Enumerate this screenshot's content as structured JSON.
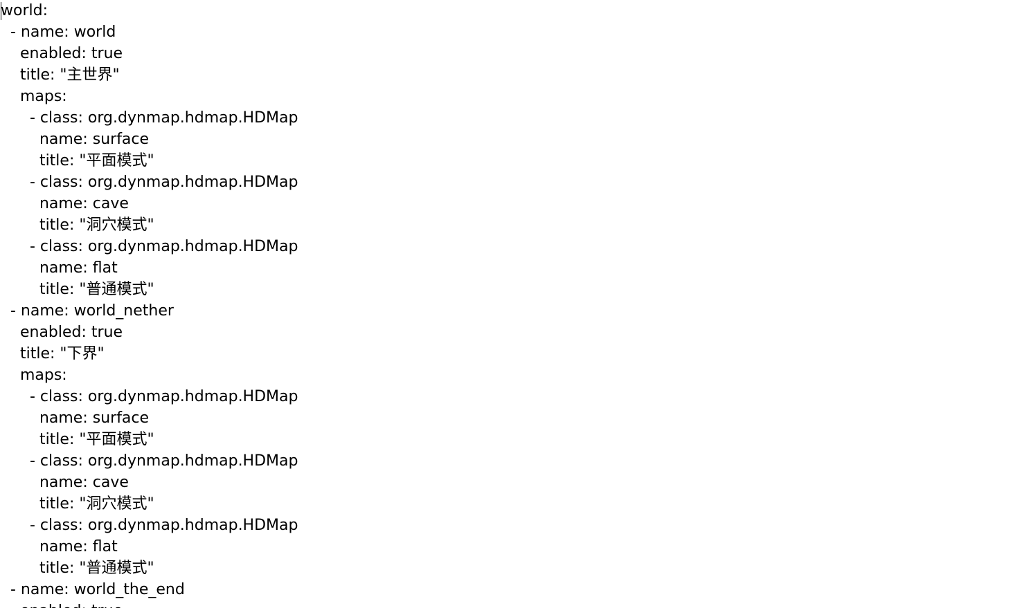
{
  "editor": {
    "lines": [
      "world:",
      "  - name: world",
      "    enabled: true",
      "    title: \"主世界\"",
      "    maps:",
      "      - class: org.dynmap.hdmap.HDMap",
      "        name: surface",
      "        title: \"平面模式\"",
      "      - class: org.dynmap.hdmap.HDMap",
      "        name: cave",
      "        title: \"洞穴模式\"",
      "      - class: org.dynmap.hdmap.HDMap",
      "        name: flat",
      "        title: \"普通模式\"",
      "  - name: world_nether",
      "    enabled: true",
      "    title: \"下界\"",
      "    maps:",
      "      - class: org.dynmap.hdmap.HDMap",
      "        name: surface",
      "        title: \"平面模式\"",
      "      - class: org.dynmap.hdmap.HDMap",
      "        name: cave",
      "        title: \"洞穴模式\"",
      "      - class: org.dynmap.hdmap.HDMap",
      "        name: flat",
      "        title: \"普通模式\"",
      "  - name: world_the_end",
      "    enabled: true"
    ]
  }
}
